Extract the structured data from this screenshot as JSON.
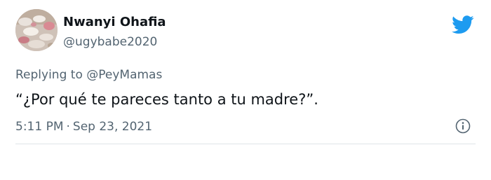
{
  "author": {
    "display_name": "Nwanyi Ohafia",
    "handle": "@ugybabe2020"
  },
  "reply": {
    "prefix": "Replying to",
    "mention": "@PeyMamas"
  },
  "tweet": {
    "text": "“¿Por qué te pareces tanto a tu madre?”."
  },
  "meta": {
    "time": "5:11 PM",
    "separator": "·",
    "date": "Sep 23, 2021"
  },
  "icons": {
    "brand": "twitter-bird-icon",
    "info": "info-icon"
  },
  "colors": {
    "accent": "#1d9bf0",
    "text_primary": "#0f1419",
    "text_secondary": "#536471",
    "divider": "#dfe4e8"
  }
}
